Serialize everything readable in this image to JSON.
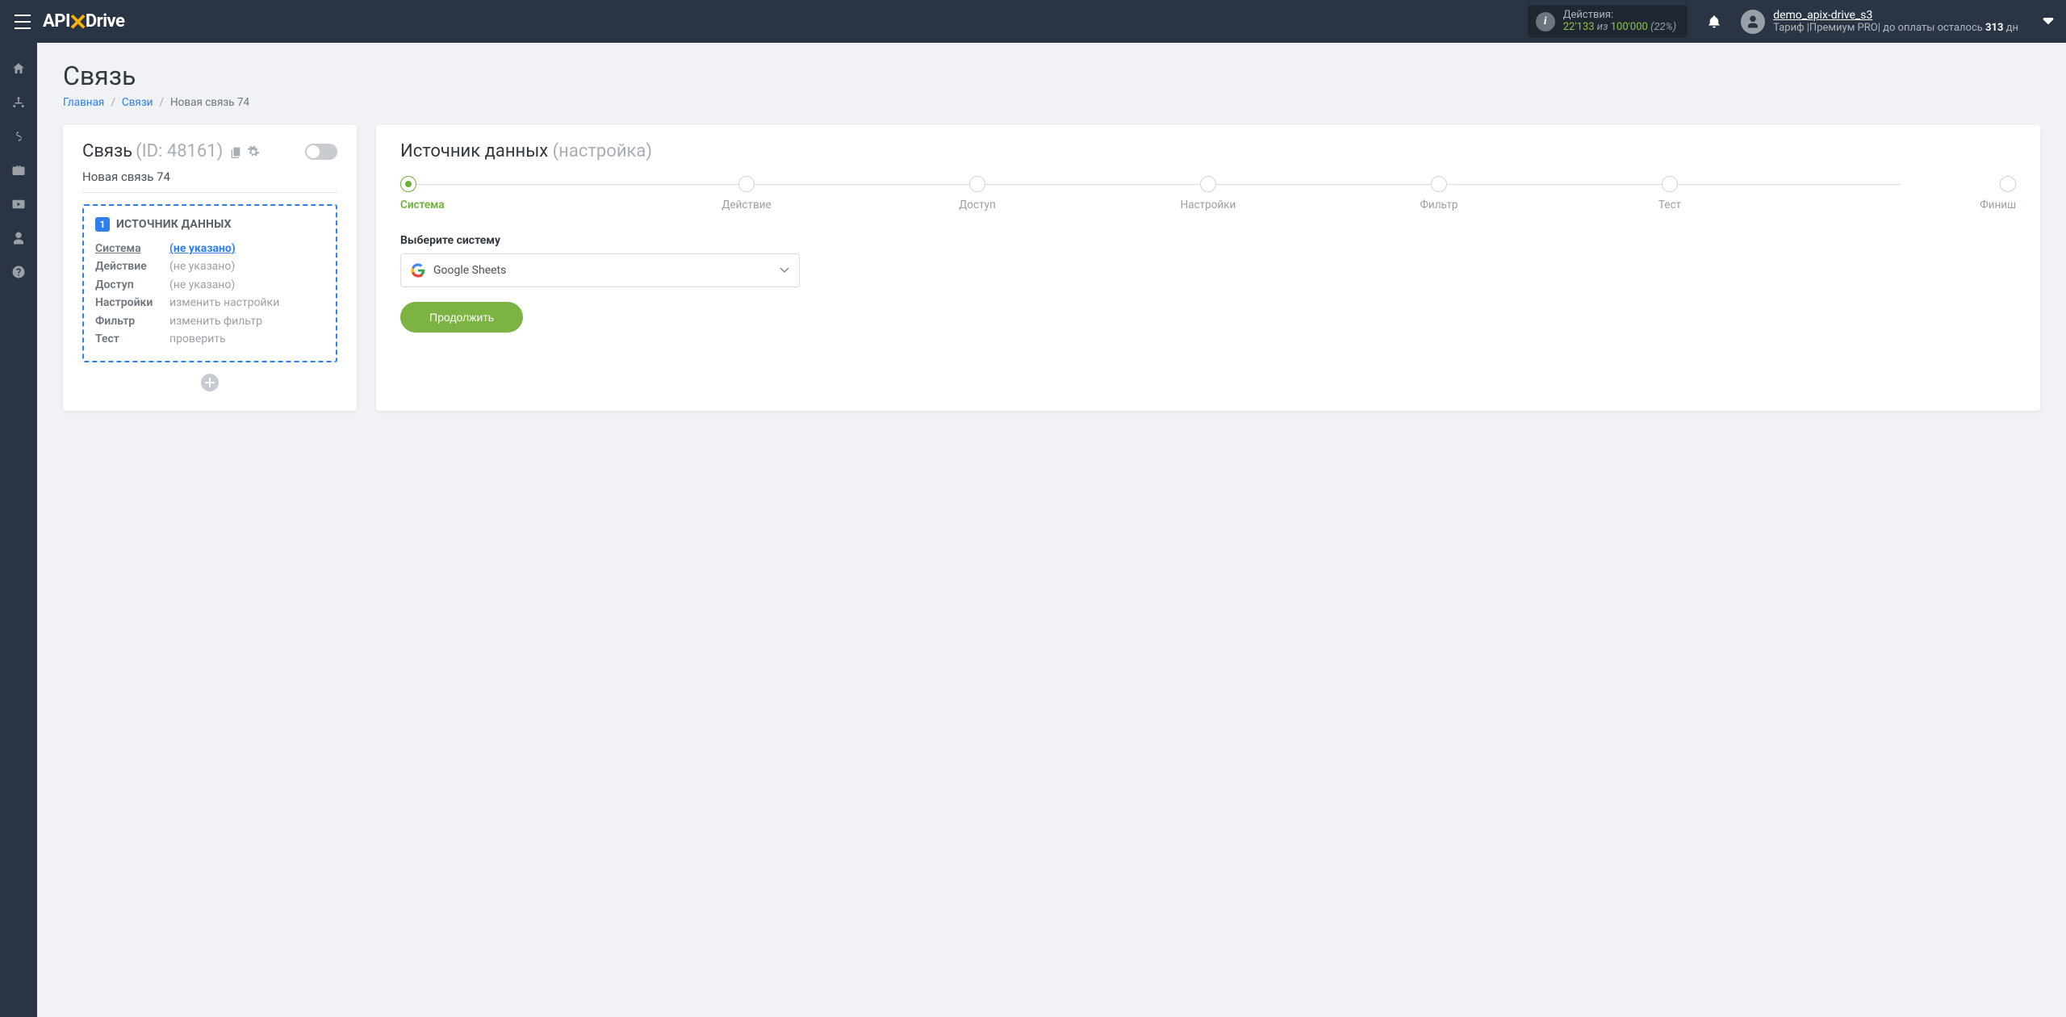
{
  "topbar": {
    "logo_prefix": "API",
    "logo_suffix": "Drive",
    "actions_label": "Действия:",
    "actions_used": "22'133",
    "actions_of": "из",
    "actions_total": "100'000",
    "actions_percent": "(22%)",
    "user_name": "demo_apix-drive_s3",
    "tariff_prefix": "Тариф |Премиум PRO| до оплаты осталось ",
    "tariff_days": "313",
    "tariff_suffix": " дн"
  },
  "page": {
    "title": "Связь",
    "breadcrumb": [
      "Главная",
      "Связи",
      "Новая связь 74"
    ]
  },
  "left": {
    "title": "Связь",
    "id_text": "(ID: 48161)",
    "conn_name": "Новая связь 74",
    "source_badge": "1",
    "source_header": "ИСТОЧНИК ДАННЫХ",
    "props": [
      {
        "key": "Система",
        "value": "(не указано)",
        "active": true
      },
      {
        "key": "Действие",
        "value": "(не указано)",
        "active": false
      },
      {
        "key": "Доступ",
        "value": "(не указано)",
        "active": false
      },
      {
        "key": "Настройки",
        "value": "изменить настройки",
        "active": false
      },
      {
        "key": "Фильтр",
        "value": "изменить фильтр",
        "active": false
      },
      {
        "key": "Тест",
        "value": "проверить",
        "active": false
      }
    ]
  },
  "right": {
    "title_main": "Источник данных ",
    "title_grey": "(настройка)",
    "steps": [
      "Система",
      "Действие",
      "Доступ",
      "Настройки",
      "Фильтр",
      "Тест",
      "Финиш"
    ],
    "active_step_index": 0,
    "field_label": "Выберите систему",
    "selected_system": "Google Sheets",
    "continue_label": "Продолжить"
  }
}
